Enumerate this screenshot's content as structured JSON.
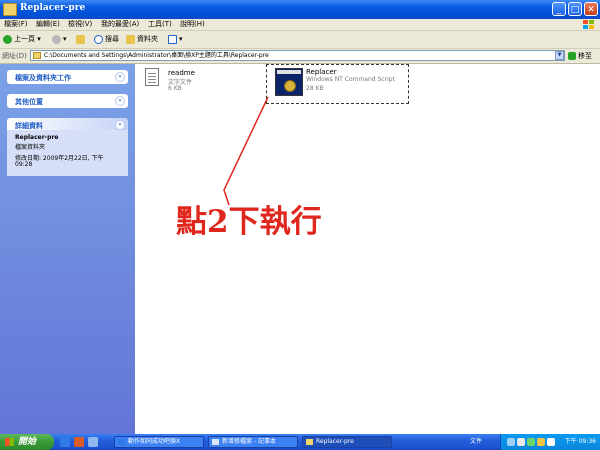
{
  "window": {
    "title": "Replacer-pre"
  },
  "menu": [
    "檔案(F)",
    "編輯(E)",
    "檢視(V)",
    "我的最愛(A)",
    "工具(T)",
    "說明(H)"
  ],
  "toolbar": {
    "back": "上一頁",
    "search": "搜尋",
    "folders": "資料夾"
  },
  "address": {
    "label": "網址(D)",
    "path": "C:\\Documents and Settings\\Administrator\\桌面\\換XP主題的工具\\Replacer-pre",
    "go": "移至"
  },
  "sidebar": {
    "boxes": [
      {
        "title": "檔案及資料夾工作"
      },
      {
        "title": "其他位置"
      },
      {
        "title": "詳細資料"
      }
    ],
    "details": {
      "name": "Replacer-pre",
      "type": "檔案資料夾",
      "modified": "修改日期: 2009年2月22日, 下午",
      "time": "09:28"
    }
  },
  "files": [
    {
      "name": "readme",
      "type": "文字文件",
      "size": "6 KB",
      "icon": "text-document-icon"
    },
    {
      "name": "Replacer",
      "type": "Windows NT Command Script",
      "size": "28 KB",
      "icon": "command-script-icon"
    }
  ],
  "annotation": "點2下執行",
  "taskbar": {
    "start": "開始",
    "tasks": [
      {
        "label": "動作如同成功吧換X"
      },
      {
        "label": "新增修檔案 - 記事本"
      },
      {
        "label": "Replacer-pre"
      }
    ],
    "lang": "文件",
    "clock": "下午 09:36"
  },
  "colors": {
    "titlebar": "#0a5ce0",
    "sidebar": "#6f8fdf",
    "annotation": "#e0271e"
  }
}
